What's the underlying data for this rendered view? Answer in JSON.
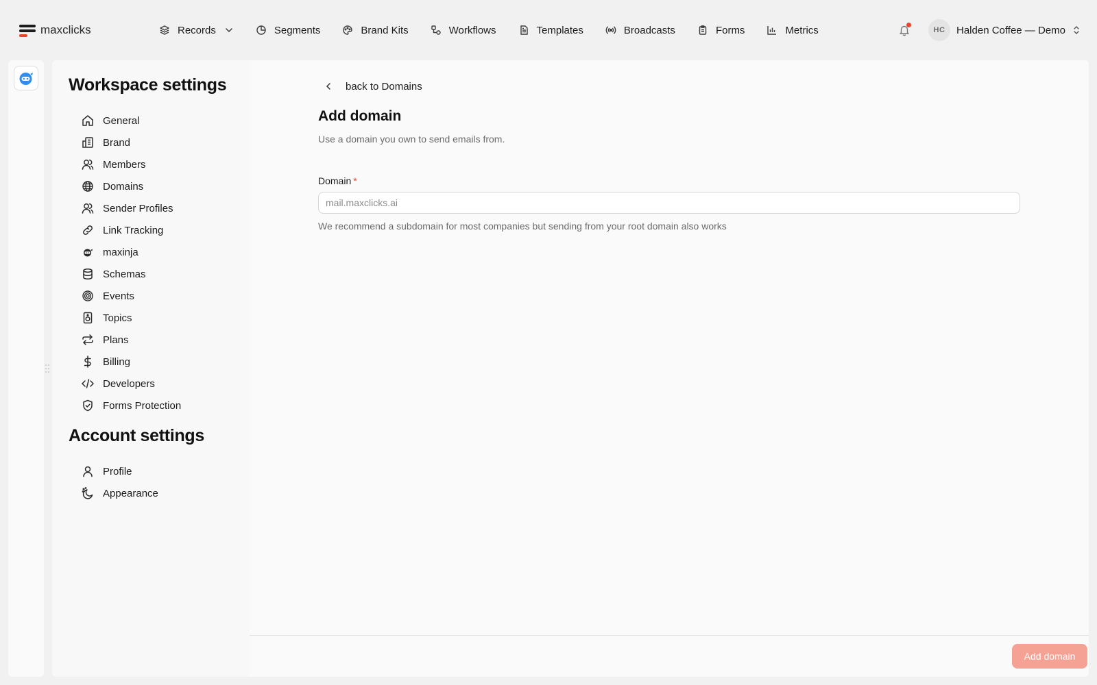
{
  "app": {
    "name": "maxclicks"
  },
  "topnav": {
    "items": [
      {
        "label": "Records",
        "icon": "layers-icon",
        "has_dropdown": true
      },
      {
        "label": "Segments",
        "icon": "pie-chart-icon"
      },
      {
        "label": "Brand Kits",
        "icon": "palette-icon"
      },
      {
        "label": "Workflows",
        "icon": "workflow-icon"
      },
      {
        "label": "Templates",
        "icon": "document-icon"
      },
      {
        "label": "Broadcasts",
        "icon": "broadcast-icon"
      },
      {
        "label": "Forms",
        "icon": "clipboard-icon"
      },
      {
        "label": "Metrics",
        "icon": "bar-chart-icon"
      }
    ],
    "notifications": {
      "icon": "bell-icon",
      "has_unread": true,
      "dot_color": "#e8452c"
    },
    "account": {
      "initials": "HC",
      "name": "Halden Coffee — Demo"
    }
  },
  "workspace_settings": {
    "title": "Workspace settings",
    "items": [
      {
        "label": "General",
        "icon": "home-icon"
      },
      {
        "label": "Brand",
        "icon": "building-icon"
      },
      {
        "label": "Members",
        "icon": "users-icon"
      },
      {
        "label": "Domains",
        "icon": "globe-icon"
      },
      {
        "label": "Sender Profiles",
        "icon": "sender-profiles-icon"
      },
      {
        "label": "Link Tracking",
        "icon": "link-icon"
      },
      {
        "label": "maxinja",
        "icon": "ninja-icon"
      },
      {
        "label": "Schemas",
        "icon": "database-icon"
      },
      {
        "label": "Events",
        "icon": "target-icon"
      },
      {
        "label": "Topics",
        "icon": "speaker-icon"
      },
      {
        "label": "Plans",
        "icon": "repeat-icon"
      },
      {
        "label": "Billing",
        "icon": "dollar-icon"
      },
      {
        "label": "Developers",
        "icon": "code-icon"
      },
      {
        "label": "Forms Protection",
        "icon": "shield-check-icon"
      }
    ]
  },
  "account_settings": {
    "title": "Account settings",
    "items": [
      {
        "label": "Profile",
        "icon": "user-icon"
      },
      {
        "label": "Appearance",
        "icon": "moon-icon"
      }
    ]
  },
  "main": {
    "back_label": "back to Domains",
    "title": "Add domain",
    "subtitle": "Use a domain you own to send emails from.",
    "domain_field": {
      "label": "Domain",
      "required_mark": "*",
      "value": "",
      "placeholder": "mail.maxclicks.ai",
      "hint": "We recommend a subdomain for most companies but sending from your root domain also works"
    },
    "submit_label": "Add domain"
  },
  "colors": {
    "accent": "#e8452c",
    "button_disabled": "#f5a193",
    "rail_app_icon": "#2f8ef0"
  }
}
